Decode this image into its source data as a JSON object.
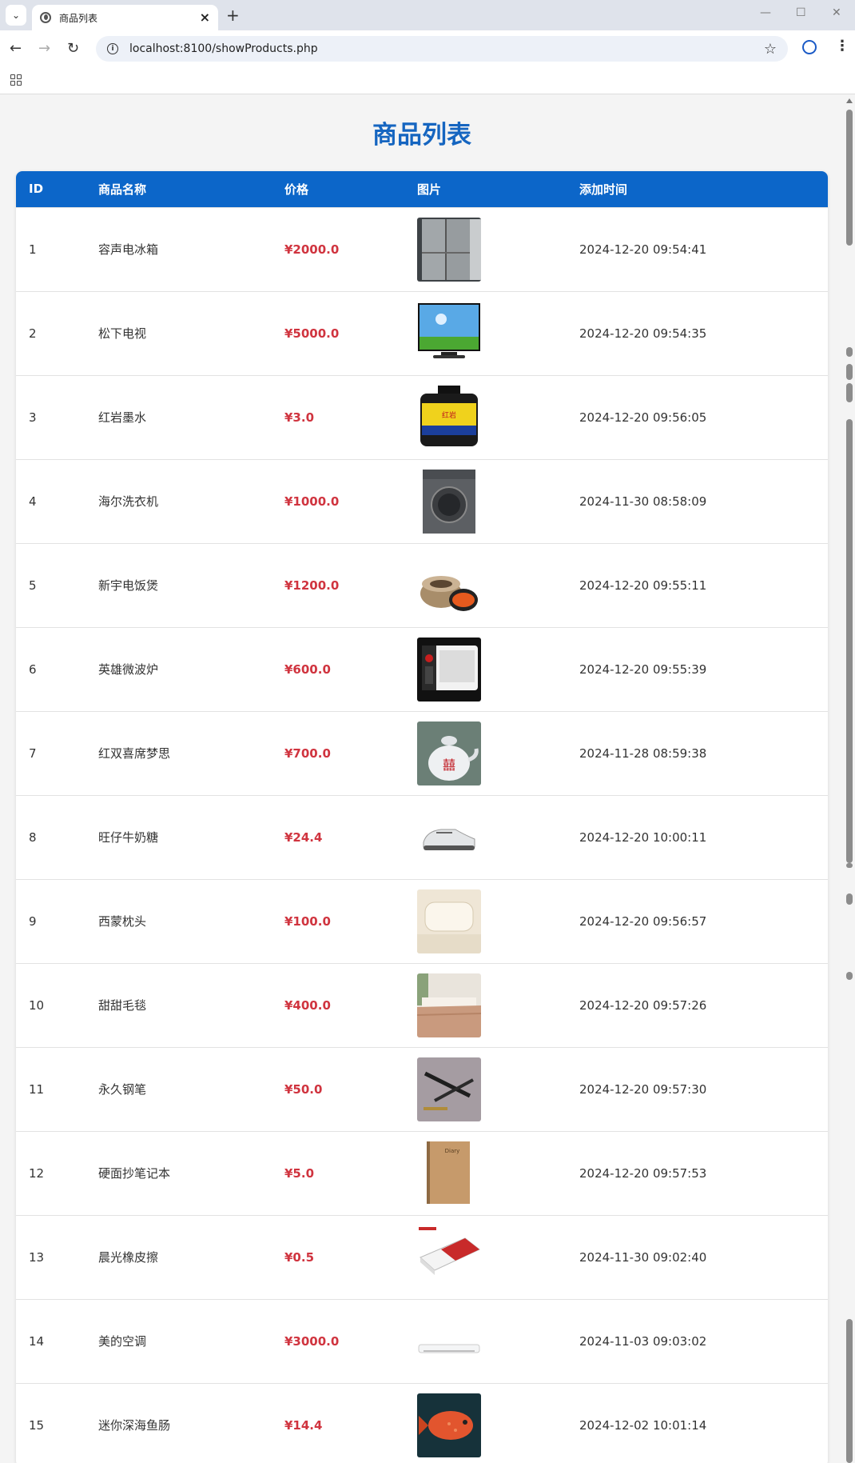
{
  "browser": {
    "tab_title": "商品列表",
    "url": "localhost:8100/showProducts.php"
  },
  "page": {
    "title": "商品列表",
    "headers": {
      "id": "ID",
      "name": "商品名称",
      "price": "价格",
      "image": "图片",
      "time": "添加时间"
    },
    "products": [
      {
        "id": "1",
        "name": "容声电冰箱",
        "price": "¥2000.0",
        "image": "fridge",
        "time": "2024-12-20 09:54:41"
      },
      {
        "id": "2",
        "name": "松下电视",
        "price": "¥5000.0",
        "image": "tv",
        "time": "2024-12-20 09:54:35"
      },
      {
        "id": "3",
        "name": "红岩墨水",
        "price": "¥3.0",
        "image": "ink-bottle",
        "time": "2024-12-20 09:56:05"
      },
      {
        "id": "4",
        "name": "海尔洗衣机",
        "price": "¥1000.0",
        "image": "washing-machine",
        "time": "2024-11-30 08:58:09"
      },
      {
        "id": "5",
        "name": "新宇电饭煲",
        "price": "¥1200.0",
        "image": "rice-cooker",
        "time": "2024-12-20 09:55:11"
      },
      {
        "id": "6",
        "name": "英雄微波炉",
        "price": "¥600.0",
        "image": "microwave",
        "time": "2024-12-20 09:55:39"
      },
      {
        "id": "7",
        "name": "红双喜席梦思",
        "price": "¥700.0",
        "image": "teapot",
        "time": "2024-11-28 08:59:38"
      },
      {
        "id": "8",
        "name": "旺仔牛奶糖",
        "price": "¥24.4",
        "image": "sneaker",
        "time": "2024-12-20 10:00:11"
      },
      {
        "id": "9",
        "name": "西蒙枕头",
        "price": "¥100.0",
        "image": "pillow",
        "time": "2024-12-20 09:56:57"
      },
      {
        "id": "10",
        "name": "甜甜毛毯",
        "price": "¥400.0",
        "image": "blanket",
        "time": "2024-12-20 09:57:26"
      },
      {
        "id": "11",
        "name": "永久钢笔",
        "price": "¥50.0",
        "image": "pen",
        "time": "2024-12-20 09:57:30"
      },
      {
        "id": "12",
        "name": "硬面抄笔记本",
        "price": "¥5.0",
        "image": "notebook",
        "time": "2024-12-20 09:57:53"
      },
      {
        "id": "13",
        "name": "晨光橡皮擦",
        "price": "¥0.5",
        "image": "eraser",
        "time": "2024-11-30 09:02:40"
      },
      {
        "id": "14",
        "name": "美的空调",
        "price": "¥3000.0",
        "image": "air-conditioner",
        "time": "2024-11-03 09:03:02"
      },
      {
        "id": "15",
        "name": "迷你深海鱼肠",
        "price": "¥14.4",
        "image": "fish",
        "time": "2024-12-02 10:01:14"
      }
    ]
  },
  "colors": {
    "header_bg": "#0c66c9",
    "title": "#1565c0",
    "price": "#d0343f"
  }
}
